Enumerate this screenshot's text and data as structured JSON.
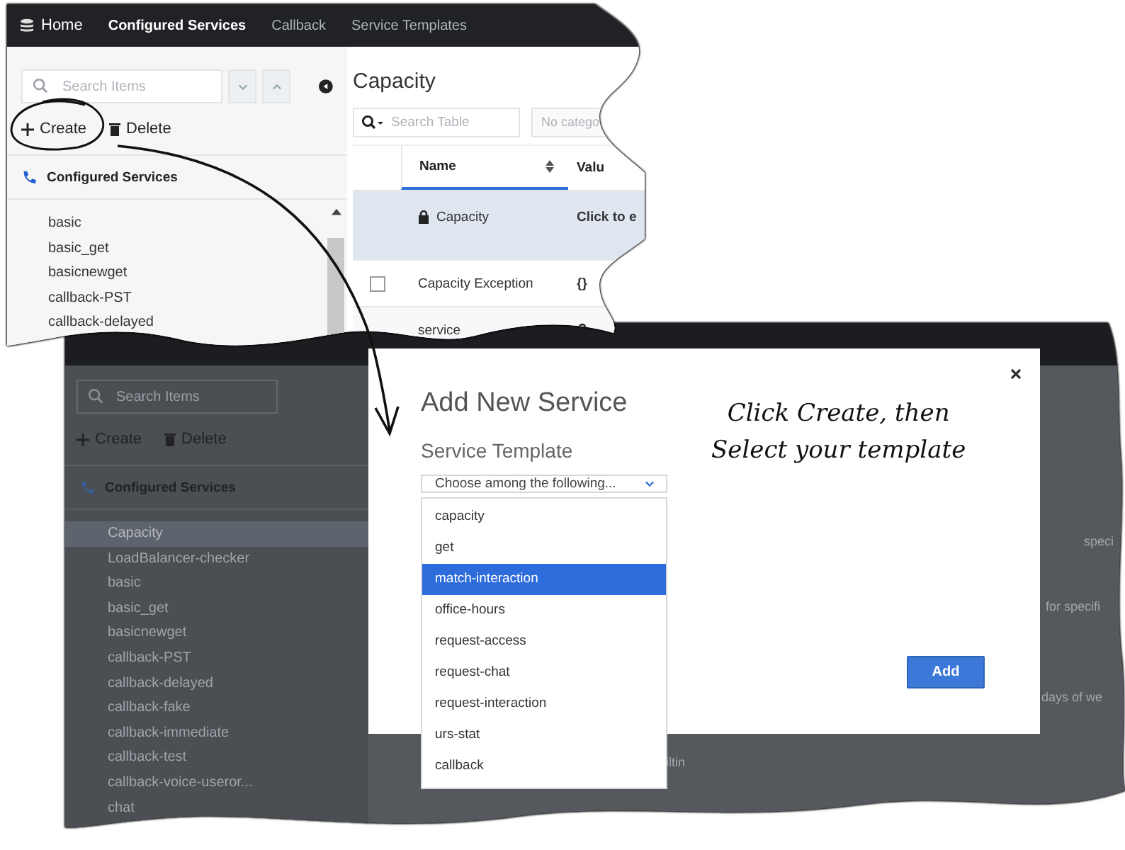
{
  "front_screenshot": {
    "nav": [
      {
        "label": "Home",
        "selected": false,
        "kind": "home"
      },
      {
        "label": "Configured Services",
        "selected": true,
        "kind": "link"
      },
      {
        "label": "Callback",
        "selected": false,
        "kind": "link"
      },
      {
        "label": "Service Templates",
        "selected": false,
        "kind": "link"
      }
    ],
    "sidebar": {
      "search_placeholder": "Search Items",
      "actions": [
        {
          "label": "Create",
          "kind": "create"
        },
        {
          "label": "Delete",
          "kind": "delete"
        }
      ],
      "section": "Configured Services",
      "items": [
        "basic",
        "basic_get",
        "basicnewget",
        "callback-PST",
        "callback-delayed"
      ]
    },
    "content": {
      "title": "Capacity",
      "search_placeholder": "Search Table",
      "filter": "No catego",
      "columns": [
        "Name",
        "Valu"
      ],
      "rows": [
        {
          "name": "Capacity",
          "value": "Click to e",
          "name_locked": true,
          "value_locked": false,
          "has_checkbox": false,
          "selected": true
        },
        {
          "name": "Capacity Exception",
          "value": "{}",
          "name_locked": false,
          "value_locked": false,
          "has_checkbox": true,
          "selected": false
        },
        {
          "name": "service",
          "name_locked": false,
          "value_locked": true,
          "has_checkbox": false,
          "selected": false
        }
      ]
    }
  },
  "back_screenshot": {
    "sidebar": {
      "search_placeholder": "Search Items",
      "actions": [
        {
          "label": "Create",
          "kind": "create"
        },
        {
          "label": "Delete",
          "kind": "delete"
        }
      ],
      "section": "Configured Services",
      "items": [
        {
          "label": "Capacity",
          "selected": true
        },
        {
          "label": "LoadBalancer-checker",
          "selected": false
        },
        {
          "label": "basic",
          "selected": false
        },
        {
          "label": "basic_get",
          "selected": false
        },
        {
          "label": "basicnewget",
          "selected": false
        },
        {
          "label": "callback-PST",
          "selected": false
        },
        {
          "label": "callback-delayed",
          "selected": false
        },
        {
          "label": "callback-fake",
          "selected": false
        },
        {
          "label": "callback-immediate",
          "selected": false
        },
        {
          "label": "callback-test",
          "selected": false
        },
        {
          "label": "callback-voice-useror...",
          "selected": false
        },
        {
          "label": "chat",
          "selected": false
        }
      ]
    },
    "fragments": [
      "speci",
      "for specifi",
      "days of we",
      "iltin"
    ]
  },
  "modal": {
    "title": "Add New Service",
    "field_label": "Service Template",
    "placeholder": "Choose among the following...",
    "options": [
      {
        "label": "capacity",
        "selected": false
      },
      {
        "label": "get",
        "selected": false
      },
      {
        "label": "match-interaction",
        "selected": true
      },
      {
        "label": "office-hours",
        "selected": false
      },
      {
        "label": "request-access",
        "selected": false
      },
      {
        "label": "request-chat",
        "selected": false
      },
      {
        "label": "request-interaction",
        "selected": false
      },
      {
        "label": "urs-stat",
        "selected": false
      },
      {
        "label": "callback",
        "selected": false
      }
    ],
    "button": "Add"
  },
  "annotation": [
    "Click Create, then",
    "Select your template"
  ]
}
